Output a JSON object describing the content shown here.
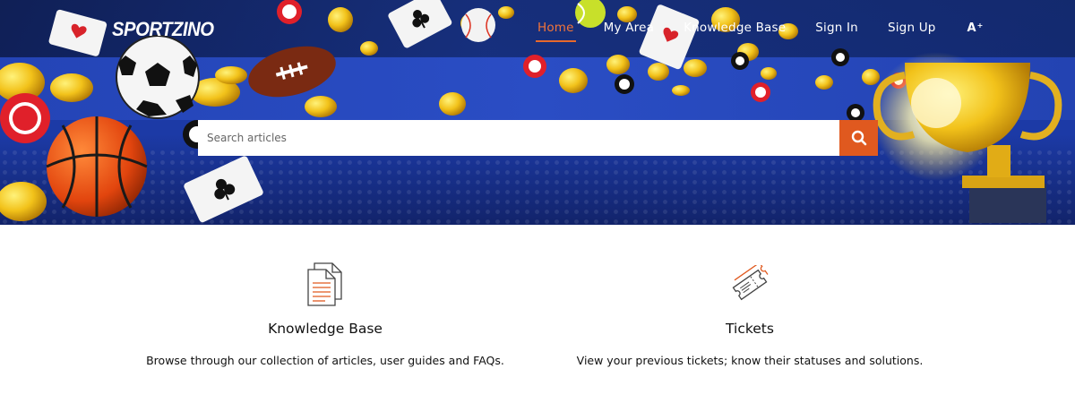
{
  "brand": {
    "name": "SPORTZINO",
    "accent": "#e0591f",
    "hero_bg": "#1c3aa6"
  },
  "nav": {
    "items": [
      {
        "label": "Home",
        "active": true
      },
      {
        "label": "My Area",
        "active": false
      },
      {
        "label": "Knowledge Base",
        "active": false
      },
      {
        "label": "Sign In",
        "active": false
      },
      {
        "label": "Sign Up",
        "active": false
      }
    ],
    "font_size_icon": "font-size-icon"
  },
  "search": {
    "placeholder": "Search articles",
    "value": "",
    "button_icon": "search-icon"
  },
  "cards": [
    {
      "icon": "documents-icon",
      "title": "Knowledge Base",
      "description": "Browse through our collection of articles, user guides and FAQs."
    },
    {
      "icon": "ticket-icon",
      "title": "Tickets",
      "description": "View your previous tickets; know their statuses and solutions."
    }
  ]
}
